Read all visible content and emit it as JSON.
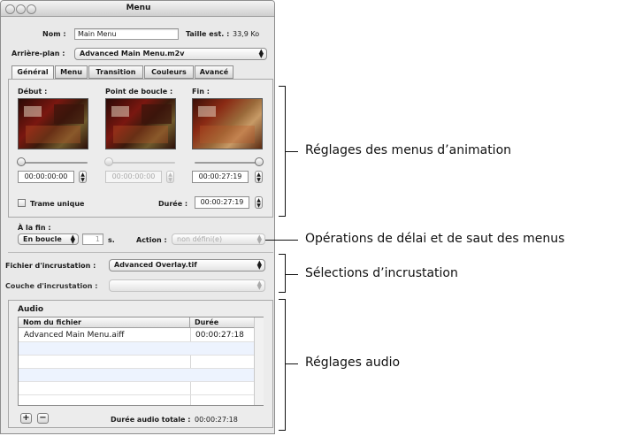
{
  "window": {
    "title": "Menu"
  },
  "form": {
    "name_label": "Nom :",
    "name_value": "Main Menu",
    "size_label": "Taille est. :",
    "size_value": "33,9 Ko",
    "background_label": "Arrière-plan :",
    "background_value": "Advanced Main Menu.m2v"
  },
  "tabs": [
    "Général",
    "Menu",
    "Transition",
    "Couleurs",
    "Avancé"
  ],
  "motion": {
    "start_label": "Début :",
    "loop_label": "Point de boucle :",
    "end_label": "Fin :",
    "start_time": "00:00:00:00",
    "loop_time": "00:00:00:00",
    "end_time": "00:00:27:19",
    "still_label": "Trame unique",
    "duration_label": "Durée :",
    "duration_value": "00:00:27:19"
  },
  "end_action": {
    "at_end_label": "À la fin :",
    "mode_value": "En boucle",
    "count_value": "1",
    "seconds_label": "s.",
    "action_label": "Action :",
    "action_value": "non défini(e)"
  },
  "overlay": {
    "file_label": "Fichier d'incrustation :",
    "file_value": "Advanced Overlay.tif",
    "layer_label": "Couche d'incrustation :",
    "layer_value": ""
  },
  "audio": {
    "section_label": "Audio",
    "columns": [
      "Nom du fichier",
      "Durée"
    ],
    "rows": [
      {
        "file": "Advanced Main Menu.aiff",
        "duration": "00:00:27:18"
      }
    ],
    "add_label": "+",
    "remove_label": "−",
    "total_label": "Durée audio totale :",
    "total_value": "00:00:27:18"
  },
  "callouts": {
    "motion": "Réglages des menus d’animation",
    "timing": "Opérations de délai et de saut des menus",
    "overlay": "Sélections d’incrustation",
    "audio": "Réglages audio"
  }
}
